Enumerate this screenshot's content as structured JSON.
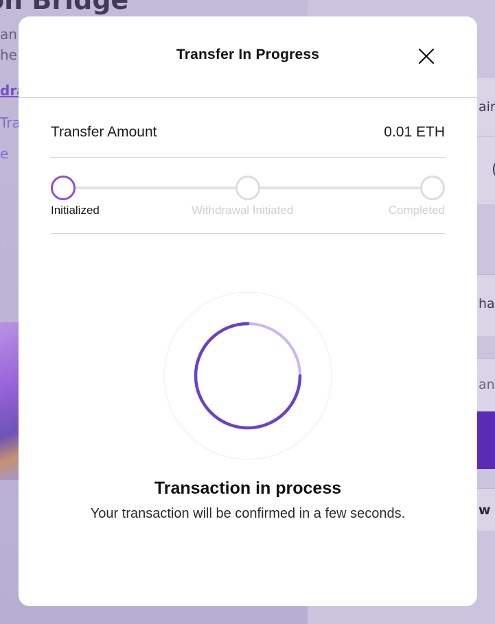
{
  "background": {
    "title": "on Bridge",
    "left_fragments": [
      "an",
      "he",
      "dra",
      "Tra",
      "e"
    ],
    "right_fragments": [
      "ain",
      "(",
      "hai",
      "ans",
      "w a"
    ]
  },
  "modal": {
    "title": "Transfer In Progress",
    "close_icon": "close-icon",
    "amount": {
      "label": "Transfer Amount",
      "value": "0.01 ETH"
    },
    "steps": [
      {
        "label": "Initialized",
        "state": "active"
      },
      {
        "label": "Withdrawal Initiated",
        "state": "pending"
      },
      {
        "label": "Completed",
        "state": "pending"
      }
    ],
    "spinner_icon": "loading-spinner-icon",
    "status_title": "Transaction in process",
    "status_subtitle": "Your transaction will be confirmed in a few seconds."
  },
  "colors": {
    "accent": "#8b4fe0",
    "spinner_dark": "#6a3fd0",
    "spinner_light": "#cdb6f0",
    "step_inactive": "#dcdce1",
    "overlay": "#bdb4d6"
  }
}
